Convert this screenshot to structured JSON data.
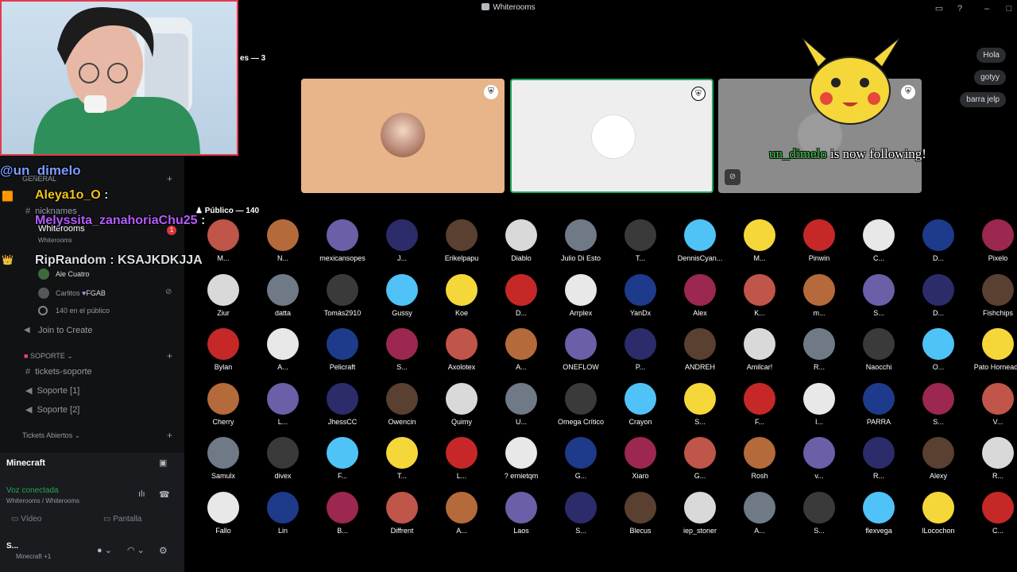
{
  "window": {
    "title": "Whiterooms"
  },
  "overlay": {
    "chat": [
      {
        "user": "@un_dimelo",
        "msg": "",
        "color": "#7b9cff"
      },
      {
        "user": "Aleya1o_O",
        "msg": " : ",
        "color": "#f0c419"
      },
      {
        "user": "Melyssita_zanahoriaChu25",
        "msg": " :",
        "color": "#b55cff"
      },
      {
        "user": "RipRandom",
        "msg": " : KSAJKDKJJA",
        "color": "#ffffff"
      }
    ],
    "right_chat": [
      "Hola",
      "gotyy",
      "barra jelp"
    ],
    "follow": {
      "user": "un_dimelo",
      "text": " is now following!"
    }
  },
  "sidebar": {
    "category_general": "GENERAL",
    "channels": [
      {
        "label": "nicknames"
      },
      {
        "label": "Whiterooms",
        "sub": "Whiterooms"
      }
    ],
    "voice_users": [
      {
        "name": "Ale Cuatro"
      },
      {
        "name": "Carlitos",
        "tag": "FGAB"
      }
    ],
    "audience": "140 en el público",
    "join": "Join to Create",
    "soporte_cat": "SOPORTE",
    "soporte_channels": [
      "tickets-soporte",
      "Soporte [1]",
      "Soporte [2]"
    ],
    "tickets_cat": "Tickets Abiertos",
    "badge": "1"
  },
  "voice_panel": {
    "server": "Minecraft",
    "status": "Voz conectada",
    "location": "Whiterooms / Whiterooms",
    "video": "Vídeo",
    "screen": "Pantalla",
    "user_short": "S...",
    "user_activity": "Minecraft +1"
  },
  "stage": {
    "speakers_label": "es — 3",
    "public_label": "Público — 140",
    "speaker_colors": [
      "#e8b489",
      "#eeeeee",
      "#8b8b8b"
    ]
  },
  "audience": [
    [
      "M...",
      "N...",
      "mexicansopes",
      "J...",
      "Erikelpapu",
      "Diablo",
      "Julio Di Esto",
      "T...",
      "DennisCyan...",
      "M...",
      "Pinwin",
      "C...",
      "D...",
      "Pixelo"
    ],
    [
      "Ziur",
      "datta",
      "Tomás2910",
      "Gussy",
      "Koe",
      "D...",
      "Arrplex",
      "YanDx",
      "Alex",
      "K...",
      "m...",
      "S...",
      "D...",
      "Fishchips"
    ],
    [
      "Bylan",
      "A...",
      "Pelicraft",
      "S...",
      "Axolotex",
      "A...",
      "ONEFLOW",
      "P...",
      "ANDREH",
      "Amilcar!",
      "R...",
      "Naocchi",
      "O...",
      "Pato Horneado"
    ],
    [
      "Cherry",
      "L...",
      "JhessCC",
      "Owencin",
      "Quimy",
      "U...",
      "Omega Crítico",
      "Crayon",
      "S...",
      "F...",
      "I...",
      "PARRA",
      "S...",
      "V..."
    ],
    [
      "Samulx",
      "divex",
      "F...",
      "T...",
      "L...",
      "? ernietqm",
      "G...",
      "Xiaro",
      "G...",
      "Rosh",
      "v...",
      "R...",
      "Alexy",
      "R..."
    ],
    [
      "Fallo",
      "Lin",
      "B...",
      "Diffrent",
      "A...",
      "Laos",
      "S...",
      "Blecus",
      "iep_stoner",
      "A...",
      "S...",
      "flexvega",
      "lLocochon",
      "C..."
    ]
  ]
}
